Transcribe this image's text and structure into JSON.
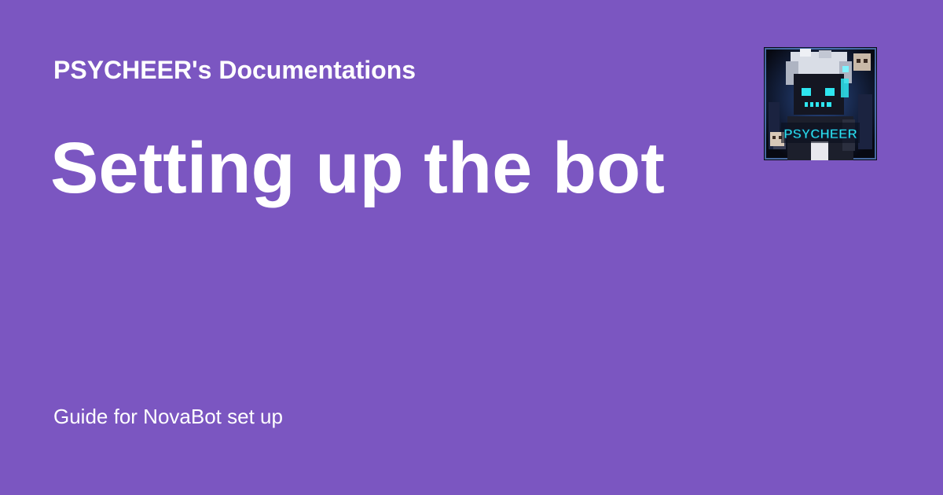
{
  "site": {
    "name": "PSYCHEER's Documentations"
  },
  "page": {
    "title": "Setting up the bot",
    "description": "Guide for NovaBot set up"
  },
  "logo": {
    "icon": "psycheer-avatar-logo",
    "text": "PSYCHEER"
  },
  "colors": {
    "background": "#7b56c1",
    "text": "#ffffff",
    "logo_accent": "#2ee6f0"
  }
}
